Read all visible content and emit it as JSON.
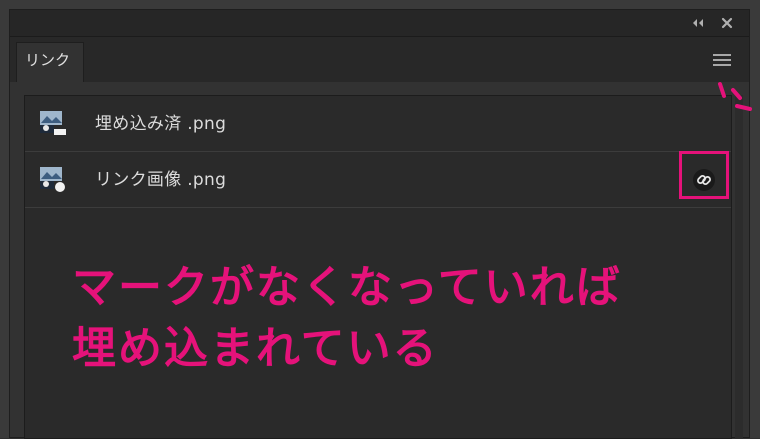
{
  "panel": {
    "tab_label": "リンク"
  },
  "links": [
    {
      "filename": "埋め込み済 .png",
      "linked": false
    },
    {
      "filename": "リンク画像 .png",
      "linked": true
    }
  ],
  "annotation": {
    "line1": "マークがなくなっていれば",
    "line2": "埋め込まれている"
  },
  "colors": {
    "accent": "#e5127a",
    "panel_bg": "#323232",
    "list_bg": "#2a2a2a"
  },
  "icons": {
    "collapse": "double-chevron-left-icon",
    "close": "close-icon",
    "menu": "hamburger-menu-icon",
    "link": "chain-link-icon"
  }
}
